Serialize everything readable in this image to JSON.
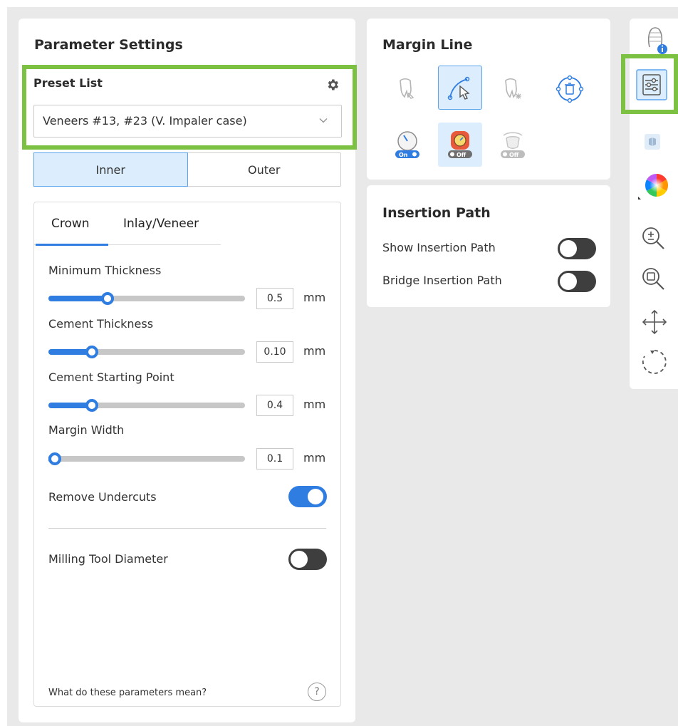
{
  "parameter_settings": {
    "title": "Parameter Settings",
    "preset_label": "Preset List",
    "preset_value": "Veneers #13, #23 (V. Impaler case)",
    "segment": {
      "inner": "Inner",
      "outer": "Outer",
      "selected": "Inner"
    },
    "tabs": {
      "crown": "Crown",
      "inlay": "Inlay/Veneer",
      "selected": "Crown"
    },
    "sliders": [
      {
        "label": "Minimum Thickness",
        "value": "0.5",
        "unit": "mm",
        "level": 0.3
      },
      {
        "label": "Cement Thickness",
        "value": "0.10",
        "unit": "mm",
        "level": 0.22
      },
      {
        "label": "Cement Starting Point",
        "value": "0.4",
        "unit": "mm",
        "level": 0.22
      },
      {
        "label": "Margin Width",
        "value": "0.1",
        "unit": "mm",
        "level": 0.0
      }
    ],
    "remove_undercuts": {
      "label": "Remove Undercuts",
      "on": true
    },
    "milling_tool": {
      "label": "Milling Tool Diameter",
      "on": false
    },
    "help_text": "What do these parameters mean?",
    "help_icon": "?"
  },
  "margin_line": {
    "title": "Margin Line",
    "toggle_on_label": "On",
    "toggle_off_label": "Off"
  },
  "insertion_path": {
    "title": "Insertion Path",
    "show_label": "Show Insertion Path",
    "show_on": false,
    "bridge_label": "Bridge Insertion Path",
    "bridge_on": false
  },
  "colors": {
    "accent": "#2f7de1",
    "highlight": "#7cc142",
    "selected_bg": "#dceefd"
  }
}
